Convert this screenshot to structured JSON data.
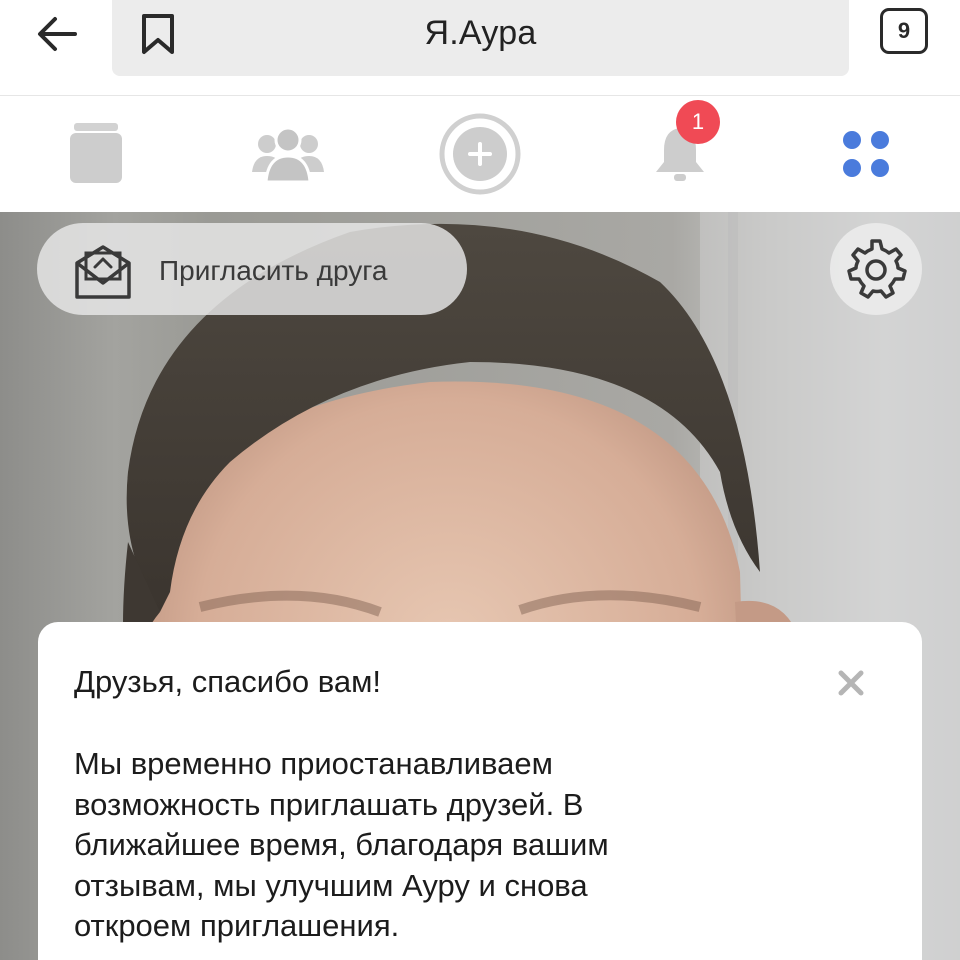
{
  "browser": {
    "back_icon": "arrow-left-icon",
    "bookmark_icon": "bookmark-icon",
    "url_title": "Я.Аура",
    "tab_count": "9"
  },
  "nav": {
    "items": [
      {
        "icon": "feed-icon"
      },
      {
        "icon": "people-icon"
      },
      {
        "icon": "add-icon"
      },
      {
        "icon": "bell-icon",
        "badge": "1"
      },
      {
        "icon": "apps-grid-icon",
        "active": true
      }
    ],
    "active_color": "#4a7bdc",
    "badge_color": "#f04a55"
  },
  "photo": {
    "invite_label": "Пригласить друга",
    "invite_icon": "envelope-invite-icon",
    "settings_icon": "gear-icon"
  },
  "card": {
    "title": "Друзья, спасибо вам!",
    "close_icon": "close-icon",
    "body_lines": [
      "Мы временно приостанавливаем",
      "возможность приглашать друзей. В",
      "ближайшее время, благодаря вашим",
      "отзывам, мы улучшим Ауру и снова",
      "откроем приглашения."
    ]
  }
}
